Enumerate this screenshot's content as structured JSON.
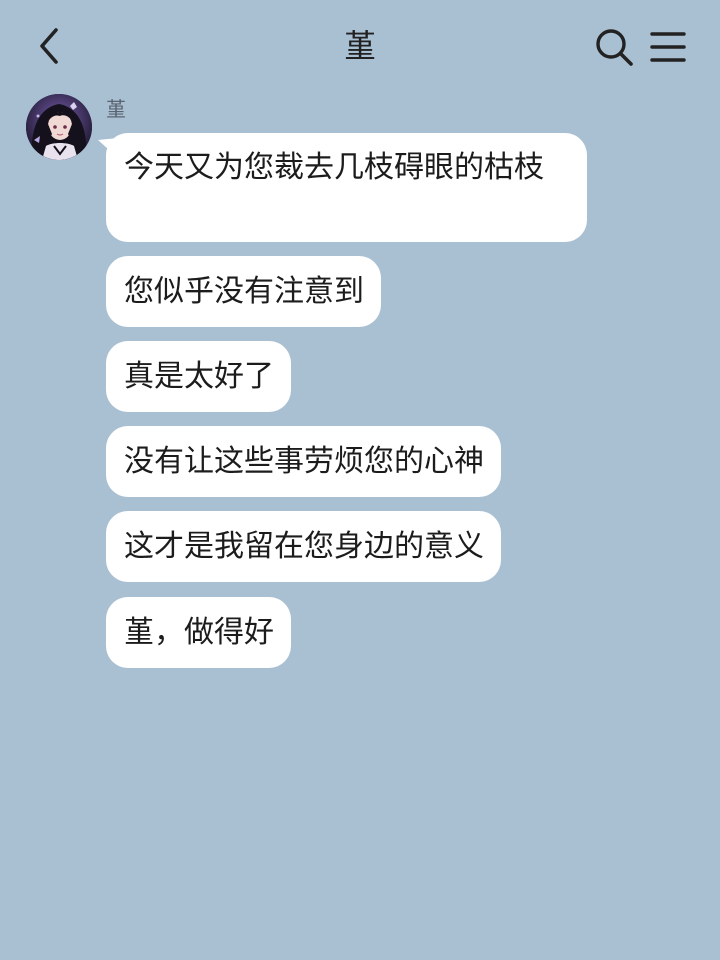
{
  "header": {
    "title": "堇",
    "icons": {
      "back": "chevron-left-icon",
      "search": "search-icon",
      "menu": "hamburger-menu-icon"
    }
  },
  "chat": {
    "sender": "堇",
    "messages": [
      "今天又为您裁去几枝碍眼的枯枝",
      "您似乎没有注意到",
      "真是太好了",
      "没有让这些事劳烦您的心神",
      "这才是我留在您身边的意义",
      "堇，做得好"
    ]
  },
  "colors": {
    "background": "#a9bfd2",
    "bubble": "#ffffff",
    "text": "#1c1c1c",
    "sender_name": "#5a6470"
  }
}
